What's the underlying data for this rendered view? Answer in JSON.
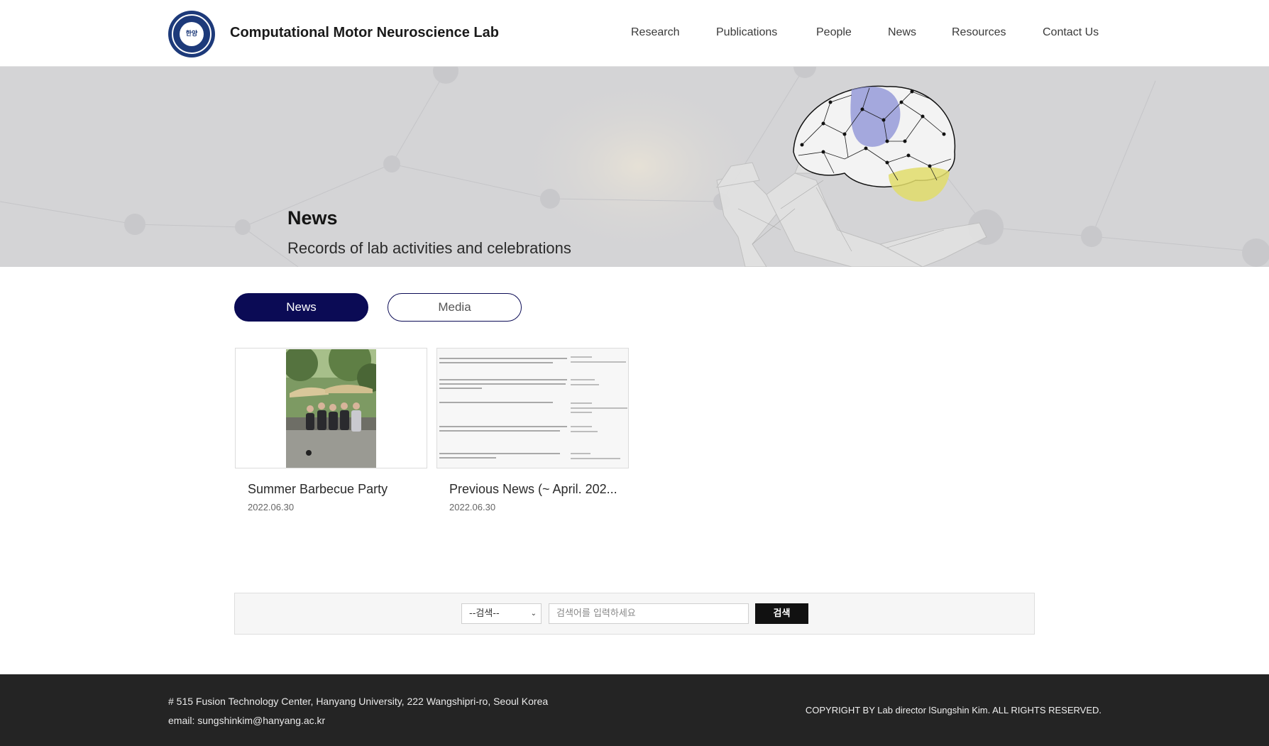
{
  "header": {
    "lab_name": "Computational Motor Neuroscience Lab",
    "logo_text": "한양",
    "nav": [
      "Research",
      "Publications",
      "People",
      "News",
      "Resources",
      "Contact Us"
    ]
  },
  "banner": {
    "title": "News",
    "subtitle": "Records of lab activities and celebrations"
  },
  "tabs": [
    {
      "label": "News",
      "active": true
    },
    {
      "label": "Media",
      "active": false
    }
  ],
  "posts": [
    {
      "title": "Summer Barbecue Party",
      "date": "2022.06.30"
    },
    {
      "title": "Previous News (~ April. 202...",
      "date": "2022.06.30"
    }
  ],
  "search": {
    "select_value": "--검색--",
    "placeholder": "검색어를 입력하세요",
    "button_label": "검색"
  },
  "footer": {
    "address": "# 515 Fusion Technology Center, Hanyang University, 222 Wangshipri-ro, Seoul Korea",
    "email": "email: sungshinkim@hanyang.ac.kr",
    "copyright": "COPYRIGHT BY Lab director lSungshin Kim. ALL RIGHTS RESERVED."
  },
  "colors": {
    "accent": "#0b0b55",
    "banner_bg": "#d4d4d6",
    "footer_bg": "#242424",
    "search_button": "#111111"
  }
}
